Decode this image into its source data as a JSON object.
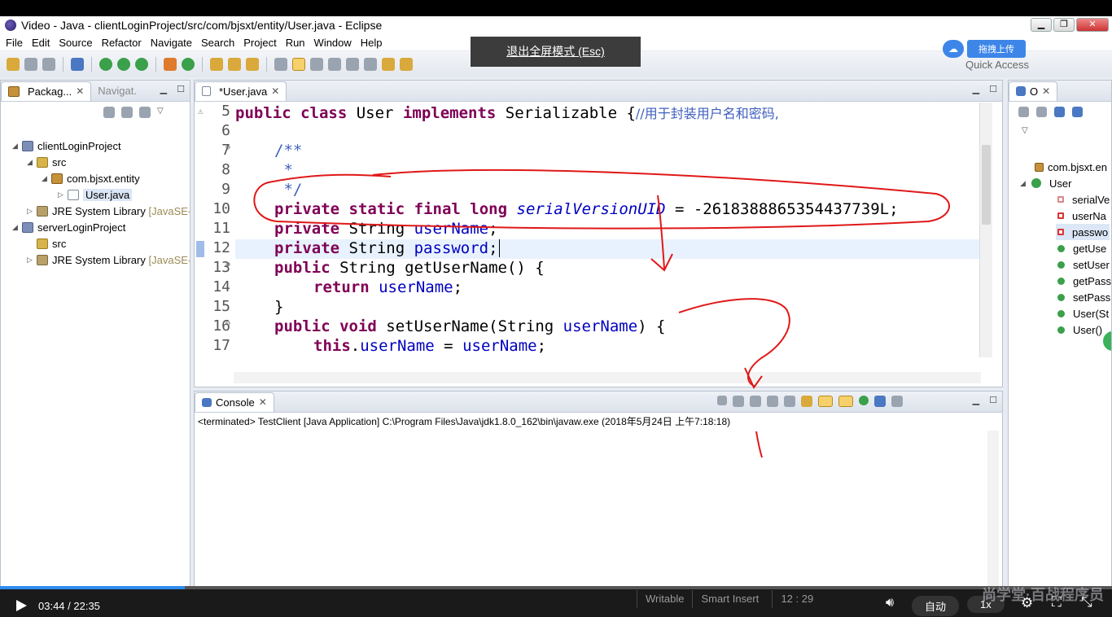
{
  "window": {
    "title": "Video - Java - clientLoginProject/src/com/bjsxt/entity/User.java - Eclipse"
  },
  "menu": [
    "File",
    "Edit",
    "Source",
    "Refactor",
    "Navigate",
    "Search",
    "Project",
    "Run",
    "Window",
    "Help"
  ],
  "fullscreen_notice": "退出全屏模式 (Esc)",
  "upload_label": "拖拽上传",
  "quick_access": "Quick Access",
  "package_explorer": {
    "tab1": "Packag...",
    "tab2": "Navigat.",
    "tree": [
      {
        "label": "clientLoginProject"
      },
      {
        "label": "src"
      },
      {
        "label": "com.bjsxt.entity"
      },
      {
        "label": "User.java"
      },
      {
        "label": "JRE System Library",
        "suffix": "[JavaSE-"
      },
      {
        "label": "serverLoginProject"
      },
      {
        "label": "src"
      },
      {
        "label": "JRE System Library",
        "suffix": "[JavaSE-"
      }
    ]
  },
  "editor": {
    "tab": "*User.java",
    "line_numbers": [
      "5",
      "6",
      "7",
      "8",
      "9",
      "10",
      "11",
      "12",
      "13",
      "14",
      "15",
      "16",
      "17"
    ],
    "lines": {
      "l5_a": "public",
      "l5_b": "class",
      "l5_c": " User ",
      "l5_d": "implements",
      "l5_e": " Serializable {",
      "l5_f": "//用于封装用户名和密码,",
      "l7": "/**",
      "l8": " *",
      "l9": " */",
      "l10_a": "private",
      "l10_b": "static",
      "l10_c": "final",
      "l10_d": "long",
      "l10_e": "serialVersionUID",
      "l10_f": " = -2618388865354437739L;",
      "l11_a": "private",
      "l11_b": " String ",
      "l11_c": "userName",
      "l11_d": ";",
      "l12_a": "private",
      "l12_b": " String ",
      "l12_c": "password",
      "l12_d": ";",
      "l13_a": "public",
      "l13_b": " String getUserName() {",
      "l14_a": "return",
      "l14_b": "userName",
      "l14_c": ";",
      "l15": "}",
      "l16_a": "public",
      "l16_b": "void",
      "l16_c": " setUserName(String ",
      "l16_d": "userName",
      "l16_e": ") {",
      "l17_a": "this",
      "l17_b": ".",
      "l17_c": "userName",
      "l17_d": " = ",
      "l17_e": "userName",
      "l17_f": ";"
    }
  },
  "console": {
    "tab": "Console",
    "status": "<terminated> TestClient [Java Application] C:\\Program Files\\Java\\jdk1.8.0_162\\bin\\javaw.exe (2018年5月24日 上午7:18:18)"
  },
  "outline": {
    "tab": "O",
    "items": [
      "com.bjsxt.en",
      "User",
      "serialVe",
      "userNa",
      "passwo",
      "getUse",
      "setUser",
      "getPass",
      "setPass",
      "User(St",
      "User()"
    ]
  },
  "statusbar": {
    "writable": "Writable",
    "insert_mode": "Smart Insert",
    "position": "12 : 29"
  },
  "player": {
    "current_time": "03:44",
    "duration": "22:35",
    "time_display": "03:44 / 22:35",
    "progress": 0.166,
    "quality": "自动",
    "speed": "1x",
    "accent_color": "#2d8cf0"
  },
  "watermark": "尚学堂·百战程序员"
}
